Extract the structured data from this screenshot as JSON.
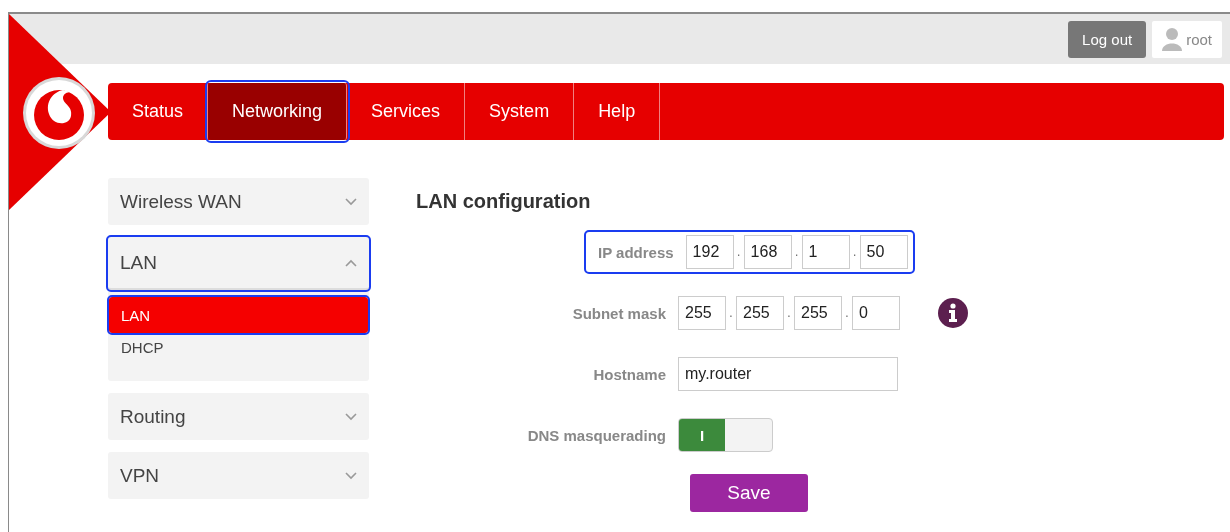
{
  "header": {
    "logout_button": "Log out",
    "user": "root"
  },
  "nav": {
    "tabs": [
      {
        "label": "Status",
        "selected": false,
        "highlighted": false
      },
      {
        "label": "Networking",
        "selected": true,
        "highlighted": true
      },
      {
        "label": "Services",
        "selected": false,
        "highlighted": false
      },
      {
        "label": "System",
        "selected": false,
        "highlighted": false
      },
      {
        "label": "Help",
        "selected": false,
        "highlighted": false
      }
    ]
  },
  "sidebar": {
    "groups": [
      {
        "label": "Wireless WAN",
        "expanded": false,
        "highlighted": false
      },
      {
        "label": "LAN",
        "expanded": true,
        "highlighted": true,
        "children": [
          {
            "label": "LAN",
            "selected": true,
            "highlighted": true
          },
          {
            "label": "DHCP",
            "selected": false,
            "highlighted": false
          }
        ]
      },
      {
        "label": "Routing",
        "expanded": false,
        "highlighted": false
      },
      {
        "label": "VPN",
        "expanded": false,
        "highlighted": false
      }
    ]
  },
  "content": {
    "title": "LAN configuration",
    "fields": [
      {
        "kind": "octets",
        "label": "IP address",
        "highlighted": true,
        "info": false,
        "values": [
          "192",
          "168",
          "1",
          "50"
        ],
        "separators": [
          ".",
          ".",
          "."
        ]
      },
      {
        "kind": "octets",
        "label": "Subnet mask",
        "highlighted": false,
        "info": true,
        "values": [
          "255",
          "255",
          "255",
          "0"
        ],
        "separators": [
          ".",
          ".",
          "."
        ]
      },
      {
        "kind": "text",
        "label": "Hostname",
        "highlighted": false,
        "info": false,
        "value": "my.router"
      },
      {
        "kind": "toggle",
        "label": "DNS masquerading",
        "highlighted": false,
        "info": false,
        "on": true,
        "on_text": "I"
      }
    ],
    "save_button": "Save"
  }
}
